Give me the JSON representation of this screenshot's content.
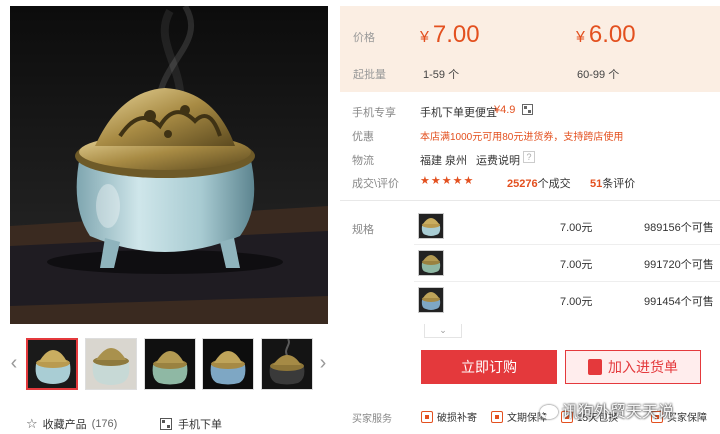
{
  "gallery": {
    "thumbnails": [
      "sky-blue censer, brass lid",
      "pale crackle censer with smoke",
      "celadon censer",
      "blue censer",
      "black censer with smoke"
    ],
    "collect_label": "收藏产品",
    "collect_count": "(176)",
    "mobile_order_label": "手机下单"
  },
  "pricing": {
    "price_label": "价格",
    "moq_label": "起批量",
    "tiers": [
      {
        "currency": "¥",
        "price": "7.00",
        "range": "1-59 个"
      },
      {
        "currency": "¥",
        "price": "6.00",
        "range": "60-99 个"
      }
    ]
  },
  "attributes": {
    "mobile_exclusive": {
      "label": "手机专享",
      "text": "手机下单更便宜",
      "amount": "¥4.9"
    },
    "discount": {
      "label": "优惠",
      "text": "本店满1000元可用80元进货券，支持跨店使用"
    },
    "logistics": {
      "label": "物流",
      "origin": "福建 泉州",
      "shipping_link": "运费说明",
      "help": "?"
    },
    "deals": {
      "label": "成交\\评价",
      "stars": "★★★★★",
      "trade_count": "25276",
      "trade_suffix": "个成交",
      "review_count": "51",
      "review_suffix": "条评价"
    }
  },
  "specs": {
    "label": "规格",
    "rows": [
      {
        "price": "7.00元",
        "stock": "989156个可售"
      },
      {
        "price": "7.00元",
        "stock": "991720个可售"
      },
      {
        "price": "7.00元",
        "stock": "991454个可售"
      }
    ],
    "expand_icon": "chevron-down"
  },
  "actions": {
    "buy_now": "立即订购",
    "add_to_cart": "加入进货单"
  },
  "services": {
    "label": "买家服务",
    "items": [
      "破损补寄",
      "文期保障",
      "15天包换",
      "买家保障"
    ]
  },
  "watermark": "讯狗外贸天天说",
  "colors": {
    "accent": "#e4393c",
    "price": "#e3501f",
    "price_bg": "#fbeee3"
  }
}
